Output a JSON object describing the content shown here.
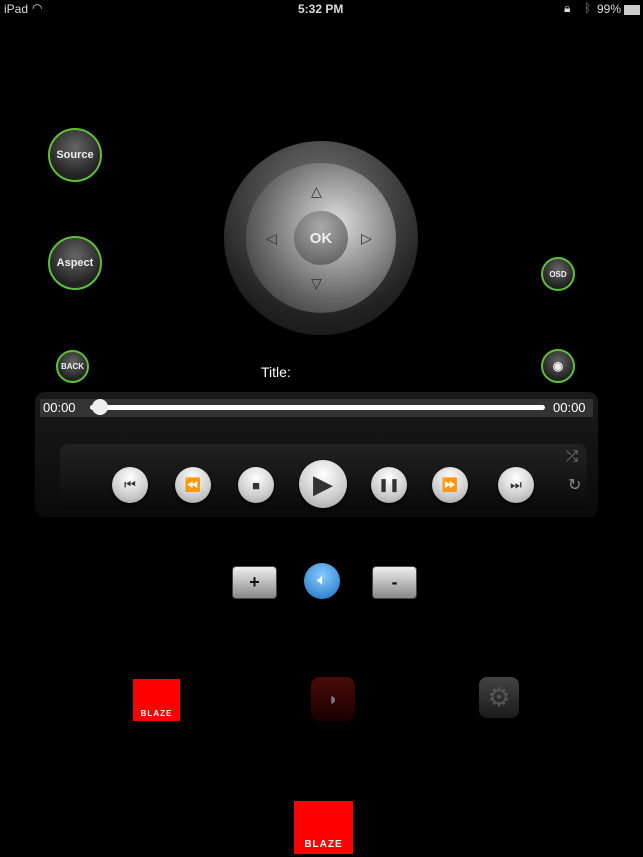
{
  "status": {
    "device": "iPad",
    "time": "5:32 PM",
    "battery": "99%"
  },
  "left": {
    "source": "Source",
    "aspect": "Aspect",
    "back": "BACK"
  },
  "right": {
    "osd": "OSD"
  },
  "dpad": {
    "ok": "OK"
  },
  "title_label": "Title:",
  "progress": {
    "elapsed": "00:00",
    "total": "00:00",
    "value": 0
  },
  "volume": {
    "plus": "+",
    "minus": "-"
  },
  "apps": {
    "blaze_logo": "BLAZE",
    "blaze_main": "BLAZE"
  },
  "colors": {
    "accent_green": "#5fbf3a",
    "brand_red": "#ff0000"
  }
}
